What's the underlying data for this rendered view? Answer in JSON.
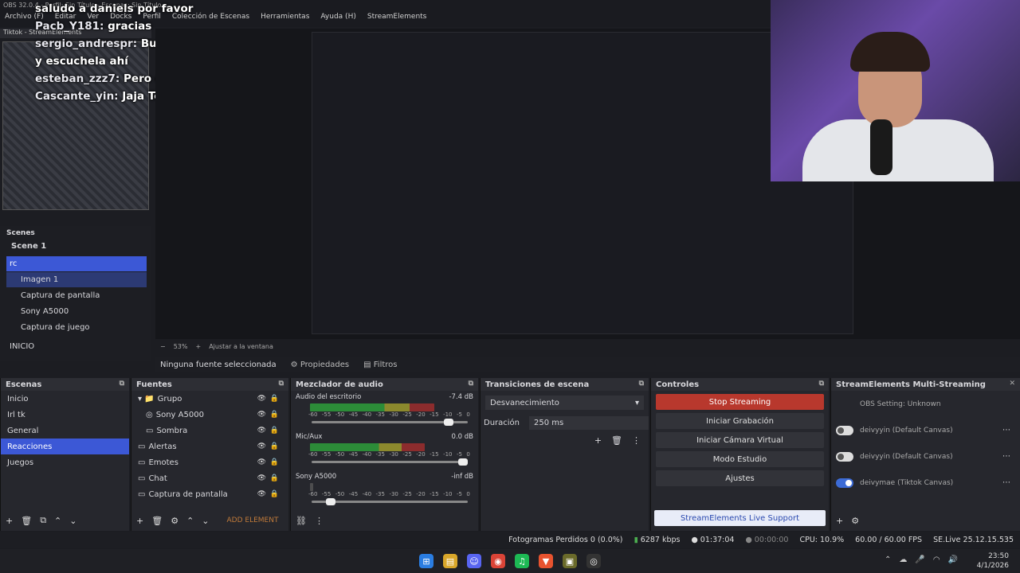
{
  "window": {
    "title": "OBS 32.0.4 - Perfil: Sin Título - Escenas: Sin Título"
  },
  "menu": [
    "Archivo (F)",
    "Editar",
    "Ver",
    "Docks",
    "Perfil",
    "Colección de Escenas",
    "Herramientas",
    "Ayuda (H)",
    "StreamElements"
  ],
  "chat": [
    {
      "user": "",
      "text": "saludo a daniels por favor"
    },
    {
      "user": "Pacb_Y181:",
      "text": "gracias"
    },
    {
      "user": "sergio_andrespr:",
      "text": "Busque barrio Antioquia y escuchela ahí"
    },
    {
      "user": "esteban_zzz7:",
      "text": "Pero escuche ps los temas"
    },
    {
      "user": "Cascante_yin:",
      "text": "Jaja Toledo 😂"
    }
  ],
  "tiktok_dock": {
    "title": "Tiktok - StreamElements"
  },
  "sources_dock": {
    "label": "Scenes",
    "scene": "Scene 1",
    "items": [
      "rc",
      "Imagen 1",
      "Captura de pantalla",
      "Sony A5000",
      "Captura de juego"
    ],
    "group": "INICIO"
  },
  "zoom": {
    "value": "53%",
    "fit": "Ajustar a la ventana"
  },
  "props": {
    "no_source": "Ninguna fuente seleccionada",
    "properties": "Propiedades",
    "filters": "Filtros"
  },
  "scenes": {
    "title": "Escenas",
    "items": [
      "Inicio",
      "Irl tk",
      "General",
      "Reacciones",
      "Juegos"
    ],
    "selected": 3
  },
  "sources": {
    "title": "Fuentes",
    "items": [
      "Grupo",
      "Sony A5000",
      "Sombra",
      "Alertas",
      "Emotes",
      "Chat",
      "Captura de pantalla"
    ],
    "add": "ADD ELEMENT"
  },
  "mixer": {
    "title": "Mezclador de audio",
    "channels": [
      {
        "name": "Audio del escritorio",
        "db": "-7.4 dB",
        "level": 0.78,
        "vol": 0.9
      },
      {
        "name": "Mic/Aux",
        "db": "0.0 dB",
        "level": 0.72,
        "vol": 1.0
      },
      {
        "name": "Sony A5000",
        "db": "-inf dB",
        "level": 0,
        "vol": 0.1
      }
    ],
    "scale": [
      "-60",
      "-55",
      "-50",
      "-45",
      "-40",
      "-35",
      "-30",
      "-25",
      "-20",
      "-15",
      "-10",
      "-5",
      "0"
    ]
  },
  "transitions": {
    "title": "Transiciones de escena",
    "type": "Desvanecimiento",
    "duration_label": "Duración",
    "duration": "250 ms"
  },
  "controls": {
    "title": "Controles",
    "buttons": [
      "Stop Streaming",
      "Iniciar Grabación",
      "Iniciar Cámara Virtual",
      "Modo Estudio",
      "Ajustes"
    ],
    "support": "StreamElements Live Support"
  },
  "multistream": {
    "title": "StreamElements Multi-Streaming",
    "rows": [
      {
        "label": "OBS Setting: Unknown",
        "on": null
      },
      {
        "label": "deivyyin (Default Canvas)",
        "on": false
      },
      {
        "label": "deivyyin (Default Canvas)",
        "on": false
      },
      {
        "label": "deivymae (Tiktok Canvas)",
        "on": true
      }
    ]
  },
  "status": {
    "dropped": "Fotogramas Perdidos 0 (0.0%)",
    "kbps": "6287 kbps",
    "live": "01:37:04",
    "rec": "00:00:00",
    "cpu": "CPU: 10.9%",
    "fps": "60.00 / 60.00 FPS",
    "version": "SE.Live 25.12.15.535"
  },
  "clock": {
    "time": "23:50",
    "date": "4/1/2026"
  },
  "colors": {
    "accent": "#3c58d6",
    "stop": "#b8382d"
  }
}
